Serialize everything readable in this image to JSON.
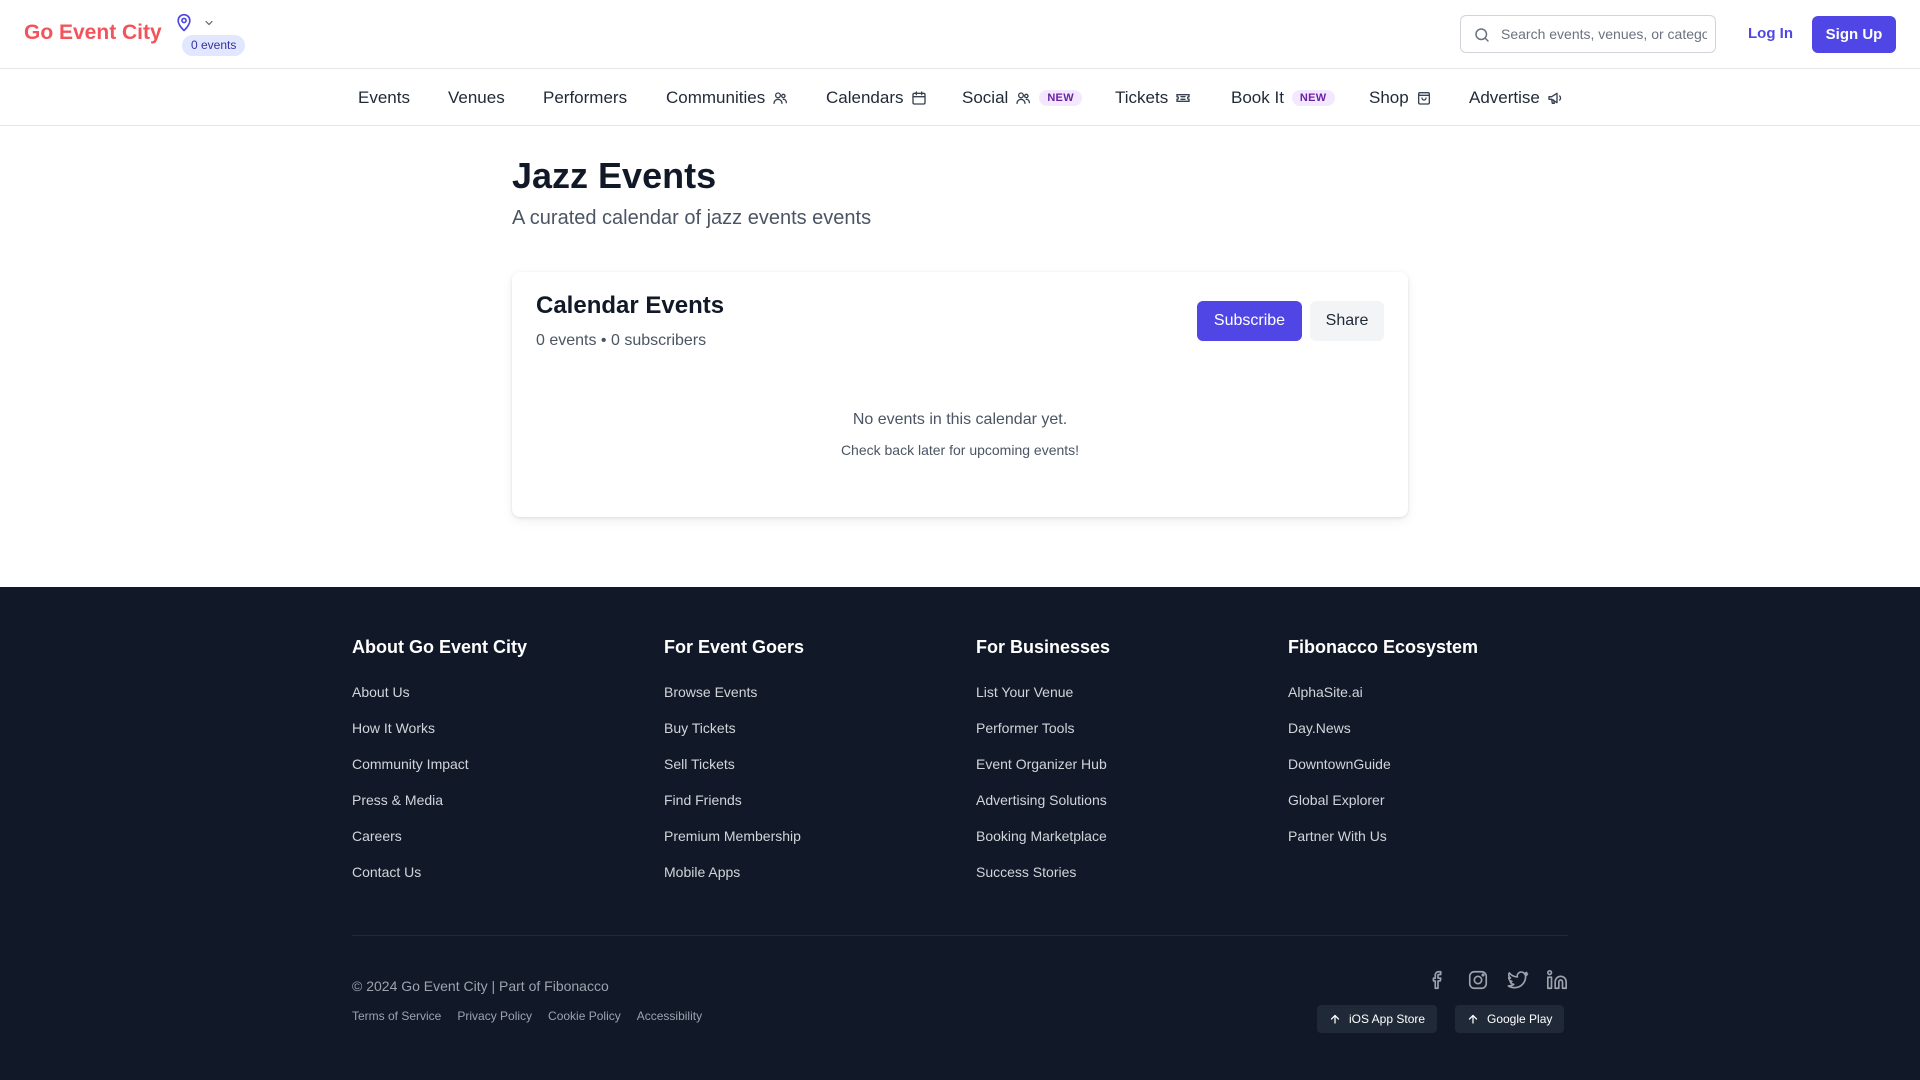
{
  "header": {
    "brand": "Go Event City",
    "location_badge": "0 events",
    "search_placeholder": "Search events, venues, or categories",
    "login_label": "Log In",
    "signup_label": "Sign Up"
  },
  "nav": {
    "items": [
      {
        "label": "Events"
      },
      {
        "label": "Venues"
      },
      {
        "label": "Performers"
      },
      {
        "label": "Communities",
        "icon": "users-icon"
      },
      {
        "label": "Calendars",
        "icon": "calendar-icon"
      },
      {
        "label": "Social",
        "icon": "users-icon",
        "badge": "NEW"
      },
      {
        "label": "Tickets",
        "icon": "ticket-icon"
      },
      {
        "label": "Book It",
        "badge": "NEW"
      },
      {
        "label": "Shop",
        "icon": "shopping-bag-icon"
      },
      {
        "label": "Advertise",
        "icon": "megaphone-icon"
      }
    ]
  },
  "main": {
    "title": "Jazz Events",
    "subtitle": "A curated calendar of jazz events events",
    "card": {
      "title": "Calendar Events",
      "meta": "0 events • 0 subscribers",
      "subscribe_label": "Subscribe",
      "share_label": "Share",
      "empty_title": "No events in this calendar yet.",
      "empty_subtitle": "Check back later for upcoming events!"
    }
  },
  "footer": {
    "columns": [
      {
        "title": "About Go Event City",
        "links": [
          "About Us",
          "How It Works",
          "Community Impact",
          "Press & Media",
          "Careers",
          "Contact Us"
        ]
      },
      {
        "title": "For Event Goers",
        "links": [
          "Browse Events",
          "Buy Tickets",
          "Sell Tickets",
          "Find Friends",
          "Premium Membership",
          "Mobile Apps"
        ]
      },
      {
        "title": "For Businesses",
        "links": [
          "List Your Venue",
          "Performer Tools",
          "Event Organizer Hub",
          "Advertising Solutions",
          "Booking Marketplace",
          "Success Stories"
        ]
      },
      {
        "title": "Fibonacco Ecosystem",
        "links": [
          "AlphaSite.ai",
          "Day.News",
          "DowntownGuide",
          "Global Explorer",
          "Partner With Us"
        ]
      }
    ],
    "copyright": "© 2024 Go Event City | Part of Fibonacco",
    "legal": [
      "Terms of Service",
      "Privacy Policy",
      "Cookie Policy",
      "Accessibility"
    ],
    "social_icons": [
      "facebook-icon",
      "instagram-icon",
      "twitter-icon",
      "linkedin-icon"
    ],
    "app_buttons": [
      "iOS App Store",
      "Google Play"
    ]
  },
  "colors": {
    "brand": "#f2545b",
    "primary": "#4f46e5",
    "footer_bg": "#111827"
  }
}
